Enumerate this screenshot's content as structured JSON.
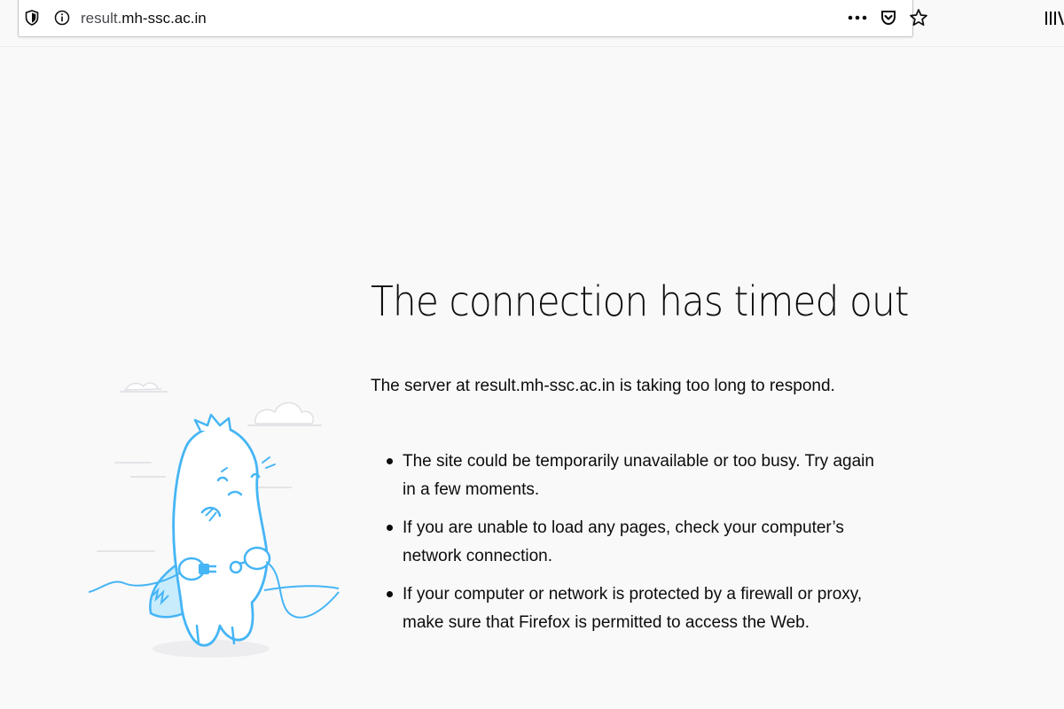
{
  "browser": {
    "url": {
      "prefix": "result.",
      "domain": "mh-ssc.ac.in"
    },
    "icons": {
      "tracking_protection": "shield-icon",
      "site_info": "info-icon",
      "page_actions": "more-horizontal-icon",
      "pocket": "pocket-icon",
      "bookmark": "star-icon",
      "library": "library-icon"
    }
  },
  "error": {
    "title": "The connection has timed out",
    "description": "The server at result.mh-ssc.ac.in is taking too long to respond.",
    "suggestions": [
      "The site could be temporarily unavailable or too busy. Try again in a few moments.",
      "If you are unable to load any pages, check your computer’s network connection.",
      "If your computer or network is protected by a firewall or proxy, make sure that Firefox is permitted to access the Web."
    ]
  },
  "colors": {
    "background": "#f9f9fa",
    "text": "#0c0c0d",
    "illustration_accent": "#45b5f5"
  }
}
